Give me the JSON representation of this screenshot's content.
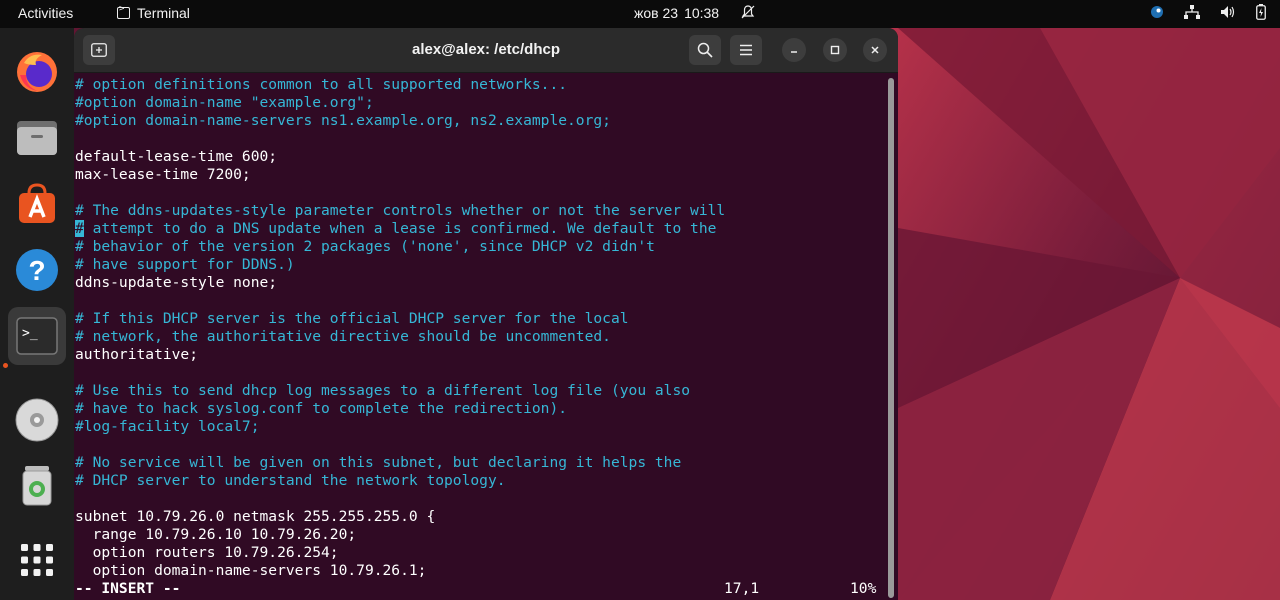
{
  "topbar": {
    "activities": "Activities",
    "app_name": "Terminal",
    "date": "жов 23",
    "time": "10:38"
  },
  "dock": {
    "items": [
      {
        "name": "firefox"
      },
      {
        "name": "files"
      },
      {
        "name": "app-center"
      },
      {
        "name": "help"
      },
      {
        "name": "terminal"
      },
      {
        "name": "dvd-drive"
      },
      {
        "name": "trash"
      },
      {
        "name": "show-apps"
      }
    ]
  },
  "window": {
    "title": "alex@alex: /etc/dhcp"
  },
  "terminal": {
    "lines": [
      {
        "text": "# option definitions common to all supported networks...",
        "type": "comment"
      },
      {
        "text": "#option domain-name \"example.org\";",
        "type": "comment"
      },
      {
        "text": "#option domain-name-servers ns1.example.org, ns2.example.org;",
        "type": "comment"
      },
      {
        "text": "",
        "type": "code"
      },
      {
        "text": "default-lease-time 600;",
        "type": "code"
      },
      {
        "text": "max-lease-time 7200;",
        "type": "code"
      },
      {
        "text": "",
        "type": "code"
      },
      {
        "text": "# The ddns-updates-style parameter controls whether or not the server will",
        "type": "comment"
      },
      {
        "text": "# attempt to do a DNS update when a lease is confirmed. We default to the",
        "type": "comment",
        "cursor": true
      },
      {
        "text": "# behavior of the version 2 packages ('none', since DHCP v2 didn't",
        "type": "comment"
      },
      {
        "text": "# have support for DDNS.)",
        "type": "comment"
      },
      {
        "text": "ddns-update-style none;",
        "type": "code"
      },
      {
        "text": "",
        "type": "code"
      },
      {
        "text": "# If this DHCP server is the official DHCP server for the local",
        "type": "comment"
      },
      {
        "text": "# network, the authoritative directive should be uncommented.",
        "type": "comment"
      },
      {
        "text": "authoritative;",
        "type": "code"
      },
      {
        "text": "",
        "type": "code"
      },
      {
        "text": "# Use this to send dhcp log messages to a different log file (you also",
        "type": "comment"
      },
      {
        "text": "# have to hack syslog.conf to complete the redirection).",
        "type": "comment"
      },
      {
        "text": "#log-facility local7;",
        "type": "comment"
      },
      {
        "text": "",
        "type": "code"
      },
      {
        "text": "# No service will be given on this subnet, but declaring it helps the",
        "type": "comment"
      },
      {
        "text": "# DHCP server to understand the network topology.",
        "type": "comment"
      },
      {
        "text": "",
        "type": "code"
      },
      {
        "text": "subnet 10.79.26.0 netmask 255.255.255.0 {",
        "type": "code"
      },
      {
        "text": "  range 10.79.26.10 10.79.26.20;",
        "type": "code"
      },
      {
        "text": "  option routers 10.79.26.254;",
        "type": "code"
      },
      {
        "text": "  option domain-name-servers 10.79.26.1;",
        "type": "code"
      }
    ],
    "status": {
      "mode": "-- INSERT --",
      "position": "17,1",
      "percent": "10%"
    }
  },
  "colors": {
    "terminal_bg": "#300a24",
    "comment": "#36b7d6",
    "accent": "#e95420"
  }
}
